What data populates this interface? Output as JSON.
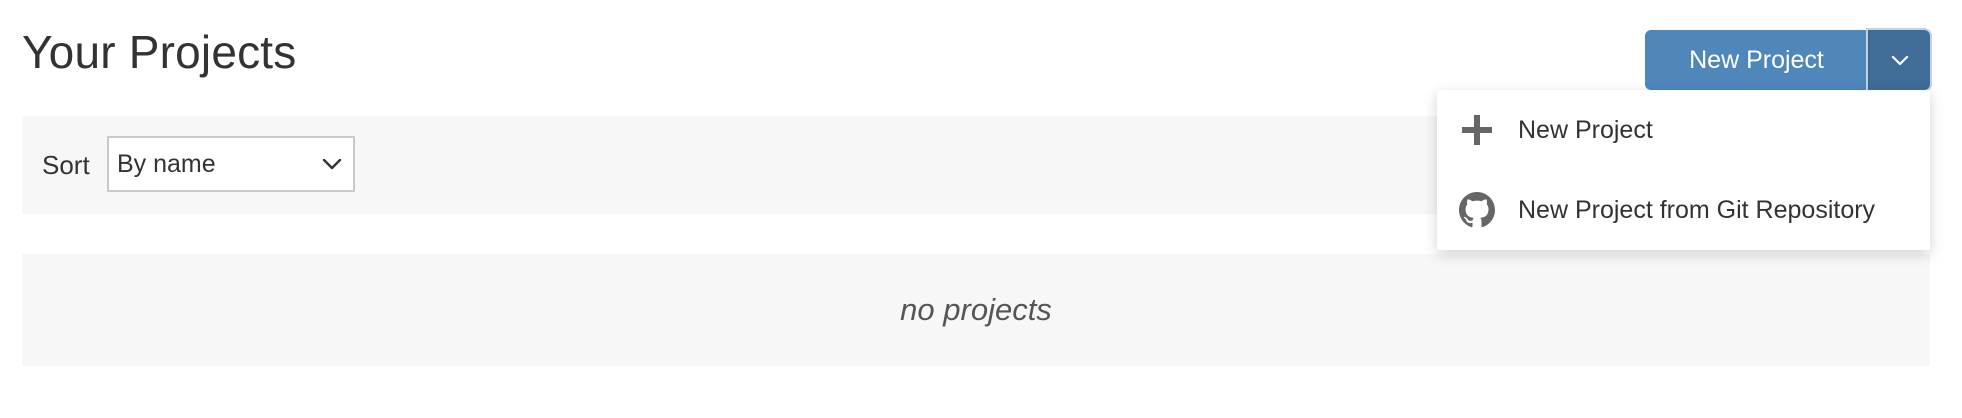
{
  "header": {
    "title": "Your Projects"
  },
  "toolbar": {
    "sort_label": "Sort",
    "sort_value": "By name"
  },
  "projects": {
    "empty_message": "no projects"
  },
  "new_project": {
    "button_label": "New Project",
    "menu": [
      {
        "label": "New Project",
        "icon": "plus-icon"
      },
      {
        "label": "New Project from Git Repository",
        "icon": "github-icon"
      }
    ]
  },
  "colors": {
    "primary": "#4f87bb",
    "primary_dark": "#3f6d98",
    "panel_bg": "#f7f7f7",
    "text": "#333333"
  }
}
